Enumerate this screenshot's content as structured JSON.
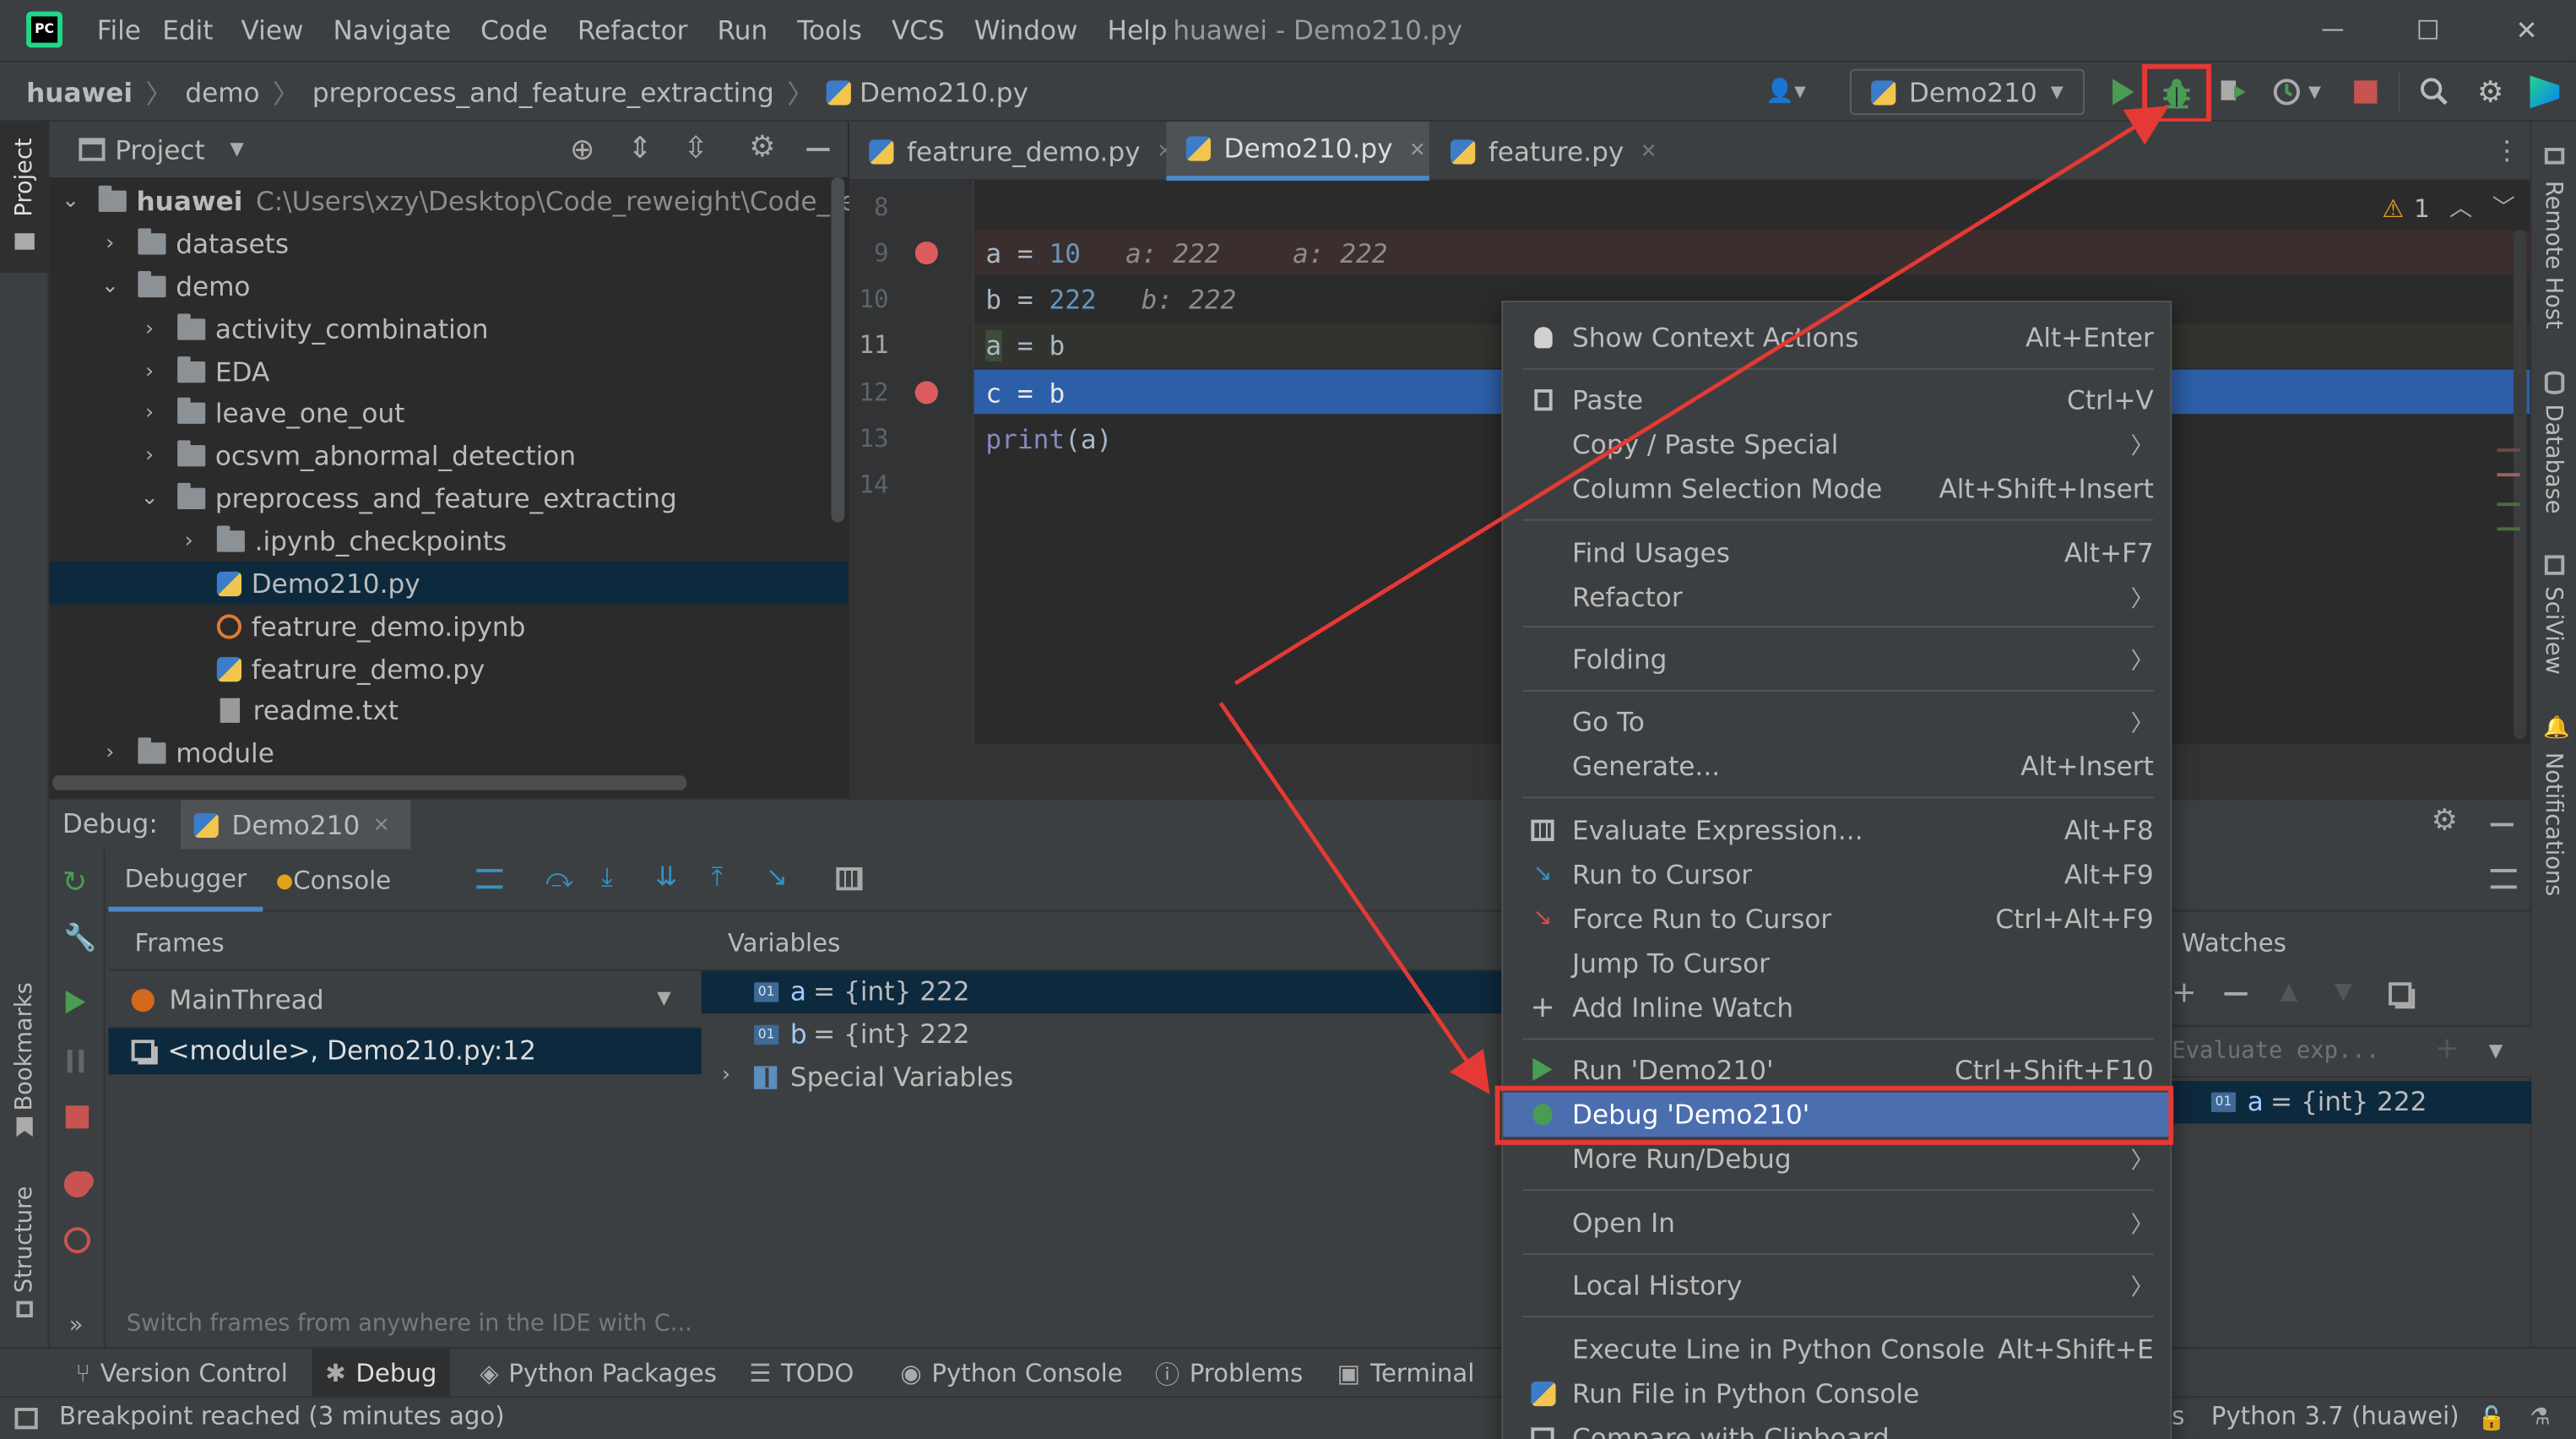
{
  "app": {
    "title": "huawei - Demo210.py",
    "logo": "PC"
  },
  "menu": [
    "File",
    "Edit",
    "View",
    "Navigate",
    "Code",
    "Refactor",
    "Run",
    "Tools",
    "VCS",
    "Window",
    "Help"
  ],
  "window_controls": {
    "minimize": "—",
    "maximize": "☐",
    "close": "✕"
  },
  "breadcrumb": [
    "huawei",
    "demo",
    "preprocess_and_feature_extracting",
    "Demo210.py"
  ],
  "run_config": {
    "name": "Demo210"
  },
  "project_panel": {
    "title": "Project"
  },
  "tree": [
    {
      "label": "huawei",
      "path": "C:\\Users\\xzy\\Desktop\\Code_reweight\\Code_reweig"
    },
    {
      "label": "datasets"
    },
    {
      "label": "demo"
    },
    {
      "label": "activity_combination"
    },
    {
      "label": "EDA"
    },
    {
      "label": "leave_one_out"
    },
    {
      "label": "ocsvm_abnormal_detection"
    },
    {
      "label": "preprocess_and_feature_extracting"
    },
    {
      "label": ".ipynb_checkpoints"
    },
    {
      "label": "Demo210.py"
    },
    {
      "label": "featrure_demo.ipynb"
    },
    {
      "label": "featrure_demo.py"
    },
    {
      "label": "readme.txt"
    },
    {
      "label": "module"
    }
  ],
  "editor_tabs": [
    "featrure_demo.py",
    "Demo210.py",
    "feature.py"
  ],
  "editor": {
    "warning_count": "1",
    "line_numbers": [
      "8",
      "9",
      "10",
      "11",
      "12",
      "13",
      "14"
    ],
    "lines": [
      {
        "var": "a",
        "op": "=",
        "val": "10",
        "hint": "a: 222",
        "hint2": "a: 222"
      },
      {
        "var": "b",
        "op": "=",
        "val": "222",
        "hint": "b: 222"
      },
      {
        "var": "a",
        "op": "=",
        "val": "b"
      },
      {
        "var": "c",
        "op": "=",
        "val": "b"
      },
      {
        "func": "print",
        "open": "(",
        "arg": "a",
        "close": ")"
      }
    ]
  },
  "context_menu": [
    {
      "label": "Show Context Actions",
      "shortcut": "Alt+Enter"
    },
    {
      "label": "Paste",
      "shortcut": "Ctrl+V"
    },
    {
      "label": "Copy / Paste Special",
      "shortcut": ""
    },
    {
      "label": "Column Selection Mode",
      "shortcut": "Alt+Shift+Insert"
    },
    {
      "label": "Find Usages",
      "shortcut": "Alt+F7"
    },
    {
      "label": "Refactor",
      "shortcut": ""
    },
    {
      "label": "Folding",
      "shortcut": ""
    },
    {
      "label": "Go To",
      "shortcut": ""
    },
    {
      "label": "Generate...",
      "shortcut": "Alt+Insert"
    },
    {
      "label": "Evaluate Expression...",
      "shortcut": "Alt+F8"
    },
    {
      "label": "Run to Cursor",
      "shortcut": "Alt+F9"
    },
    {
      "label": "Force Run to Cursor",
      "shortcut": "Ctrl+Alt+F9"
    },
    {
      "label": "Jump To Cursor",
      "shortcut": ""
    },
    {
      "label": "Add Inline Watch",
      "shortcut": ""
    },
    {
      "label": "Run 'Demo210'",
      "shortcut": "Ctrl+Shift+F10"
    },
    {
      "label": "Debug 'Demo210'",
      "shortcut": ""
    },
    {
      "label": "More Run/Debug",
      "shortcut": ""
    },
    {
      "label": "Open In",
      "shortcut": ""
    },
    {
      "label": "Local History",
      "shortcut": ""
    },
    {
      "label": "Execute Line in Python Console",
      "shortcut": "Alt+Shift+E"
    },
    {
      "label": "Run File in Python Console",
      "shortcut": ""
    },
    {
      "label": "Compare with Clipboard",
      "shortcut": ""
    }
  ],
  "debug": {
    "label": "Debug:",
    "config": "Demo210",
    "tabs": [
      "Debugger",
      "Console"
    ],
    "frames_header": "Frames",
    "thread": "MainThread",
    "frame": "<module>, Demo210.py:12",
    "hint": "Switch frames from anywhere in the IDE with C...",
    "variables_header": "Variables",
    "variables": [
      {
        "name": "a",
        "value": "= {int} 222"
      },
      {
        "name": "b",
        "value": "= {int} 222"
      },
      {
        "name": "Special Variables",
        "value": ""
      }
    ],
    "watches_header": "Watches",
    "evaluate_placeholder": "Evaluate exp...",
    "watch": {
      "name": "a",
      "value": "= {int} 222"
    }
  },
  "bottom_tabs": [
    "Version Control",
    "Debug",
    "Python Packages",
    "TODO",
    "Python Console",
    "Problems",
    "Terminal"
  ],
  "status": {
    "message": "Breakpoint reached (3 minutes ago)",
    "interpreter": "Python 3.7 (huawei)",
    "fragment": "s"
  },
  "left_tabs": [
    "Project",
    "Bookmarks",
    "Structure"
  ],
  "right_tabs": [
    "Remote Host",
    "Database",
    "SciView",
    "Notifications"
  ],
  "colors": {
    "accent": "#2f65ca",
    "highlight_border": "#e53935",
    "breakpoint": "#db5c5c",
    "run_green": "#499c54"
  }
}
